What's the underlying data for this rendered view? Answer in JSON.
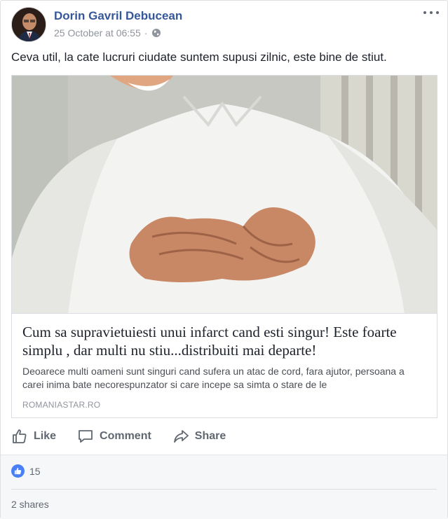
{
  "post": {
    "author": "Dorin Gavril Debucean",
    "timestamp": "25 October at 06:55",
    "separator": "·",
    "privacy_icon": "globe-icon",
    "more_icon": "more-options-icon",
    "text": "Ceva util, la cate lucruri ciudate suntem supusi zilnic, este bine de stiut."
  },
  "link": {
    "image": "man-clutching-chest-photo",
    "title": "Cum sa supravietuiesti unui infarct cand esti singur! Este foarte simplu , dar multi nu stiu...distribuiti mai departe!",
    "description": "Deoarece multi oameni sunt singuri cand sufera un atac de cord, fara ajutor, persoana a carei inima bate necorespunzator si care incepe sa simta o stare de le",
    "domain": "ROMANIASTAR.RO"
  },
  "actions": {
    "like_label": "Like",
    "comment_label": "Comment",
    "share_label": "Share"
  },
  "reactions": {
    "like_count": "15",
    "shares_text": "2 shares"
  },
  "colors": {
    "author_link": "#365899",
    "meta_text": "#90949c",
    "like_blue": "#4a80f5",
    "footer_bg": "#f6f7f9"
  }
}
